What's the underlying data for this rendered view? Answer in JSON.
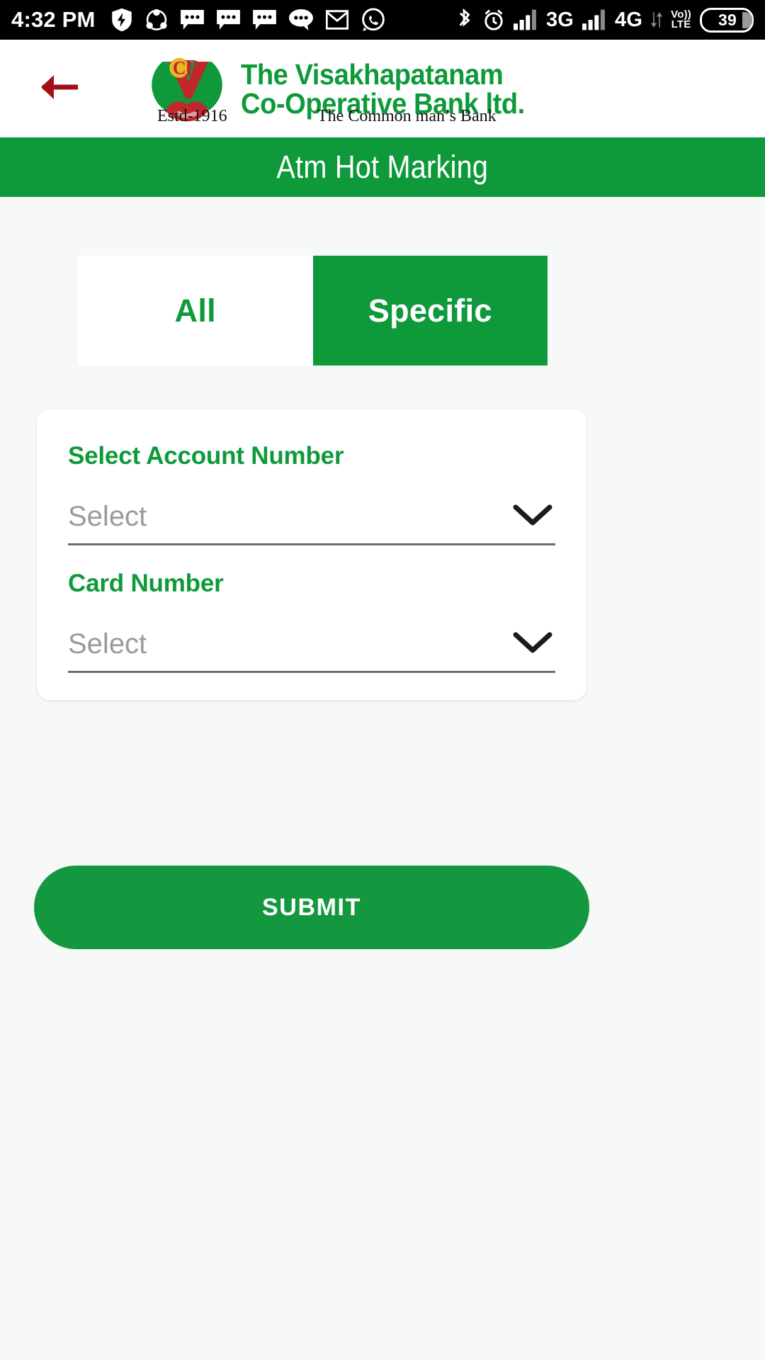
{
  "status_bar": {
    "time": "4:32 PM",
    "left_icons": [
      "shield-icon",
      "share-icon",
      "message-icon",
      "message-icon",
      "message-icon",
      "chat-bubble-icon",
      "gmail-icon",
      "whatsapp-icon"
    ],
    "bluetooth_icon": "bluetooth-icon",
    "alarm_icon": "alarm-icon",
    "network_1": "3G",
    "network_2": "4G",
    "volte_top": "Vo))",
    "volte_bottom": "LTE",
    "battery_level": "39"
  },
  "header": {
    "back_icon": "back-arrow-icon",
    "logo_icon": "bank-logo-icon",
    "brand_line1": "The Visakhapatanam",
    "brand_line2": "Co-Operative Bank ltd.",
    "established": "Estd-1916",
    "tagline": "The Common man’s Bank",
    "brand_color": "#0e9a3a"
  },
  "title_bar": {
    "title": "Atm Hot Marking",
    "background": "#0e9a3a"
  },
  "segment": {
    "options": [
      {
        "label": "All",
        "active": false
      },
      {
        "label": "Specific",
        "active": true
      }
    ]
  },
  "form": {
    "fields": [
      {
        "label": "Select Account Number",
        "value": "Select",
        "chevron_icon": "chevron-down-icon"
      },
      {
        "label": "Card Number",
        "value": "Select",
        "chevron_icon": "chevron-down-icon"
      }
    ]
  },
  "submit": {
    "label": "SUBMIT",
    "color": "#14983f"
  }
}
